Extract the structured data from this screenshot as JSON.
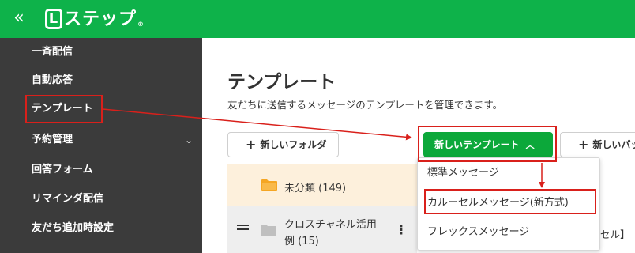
{
  "header": {
    "collapse_glyph": "«",
    "logo_letter": "L",
    "logo_text": "ステップ",
    "logo_mark": "®",
    "bg_color": "#0eb24a"
  },
  "sidebar": {
    "bg_color": "#3b3b3b",
    "items": [
      {
        "label": "一斉配信"
      },
      {
        "label": "自動応答"
      },
      {
        "label": "テンプレート"
      },
      {
        "label": "予約管理",
        "chevron": "⌄"
      },
      {
        "label": "回答フォーム"
      },
      {
        "label": "リマインダ配信"
      },
      {
        "label": "友だち追加時設定"
      }
    ]
  },
  "main": {
    "title": "テンプレート",
    "description": "友だちに送信するメッセージのテンプレートを管理できます。",
    "new_folder_button": {
      "icon": "+",
      "label": "新しいフォルダ"
    },
    "new_template_button": {
      "label": "新しいテンプレート",
      "caret": "︿",
      "color": "#0ca83a"
    },
    "new_pack_button": {
      "icon": "+",
      "label": "新しいパッ"
    },
    "folders": [
      {
        "name": "未分類 (149)",
        "active": true,
        "icon": "folder-icon",
        "icon_color": "#f5a623"
      },
      {
        "name_line1": "クロスチャネル活用",
        "name_line2": "例 (15)",
        "active": false,
        "icon": "folder-icon",
        "icon_color": "#bfbfbf",
        "menu_glyph": "⋮"
      }
    ],
    "obscured_text": "セル】"
  },
  "dropdown": {
    "items": [
      {
        "label": "標準メッセージ"
      },
      {
        "label": "カルーセルメッセージ(新方式)"
      },
      {
        "label": "フレックスメッセージ"
      }
    ]
  },
  "annotation_color": "#d9201b"
}
